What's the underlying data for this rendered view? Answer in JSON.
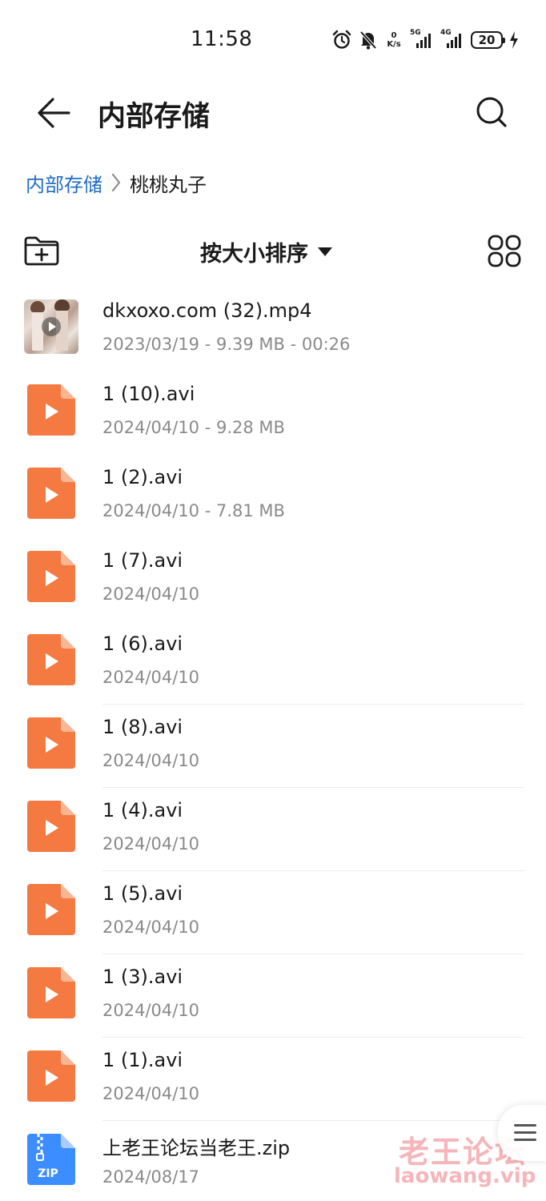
{
  "status_bar": {
    "time": "11:58",
    "net_speed_value": "0",
    "net_speed_unit": "K/s",
    "signal_1_label": "5G",
    "signal_2_label": "4G",
    "battery": "20",
    "icons": [
      "alarm-icon",
      "mute-icon",
      "signal-icon",
      "battery-icon",
      "charging-icon"
    ]
  },
  "header": {
    "title": "内部存储"
  },
  "breadcrumb": {
    "root": "内部存储",
    "current": "桃桃丸子"
  },
  "toolbar": {
    "sort_label": "按大小排序"
  },
  "colors": {
    "accent": "#1f6cc8",
    "video_icon": "#f47a42",
    "zip_icon": "#3c8dff"
  },
  "files": [
    {
      "name": "dkxoxo.com (32).mp4",
      "meta": "2023/03/19 - 9.39 MB - 00:26",
      "type": "video-thumb"
    },
    {
      "name": "1 (10).avi",
      "meta": "2024/04/10 - 9.28 MB",
      "type": "video"
    },
    {
      "name": "1 (2).avi",
      "meta": "2024/04/10 - 7.81 MB",
      "type": "video"
    },
    {
      "name": "1 (7).avi",
      "meta": "2024/04/10",
      "type": "video"
    },
    {
      "name": "1 (6).avi",
      "meta": "2024/04/10",
      "type": "video"
    },
    {
      "name": "1 (8).avi",
      "meta": "2024/04/10",
      "type": "video"
    },
    {
      "name": "1 (4).avi",
      "meta": "2024/04/10",
      "type": "video"
    },
    {
      "name": "1 (5).avi",
      "meta": "2024/04/10",
      "type": "video"
    },
    {
      "name": "1 (3).avi",
      "meta": "2024/04/10",
      "type": "video"
    },
    {
      "name": "1 (1).avi",
      "meta": "2024/04/10",
      "type": "video"
    },
    {
      "name": "上老王论坛当老王.zip",
      "meta": "2024/08/17",
      "type": "zip",
      "icon_label": "ZIP"
    }
  ],
  "watermark": {
    "text_cn": "老王论坛",
    "text_en": "laowang.vip"
  }
}
